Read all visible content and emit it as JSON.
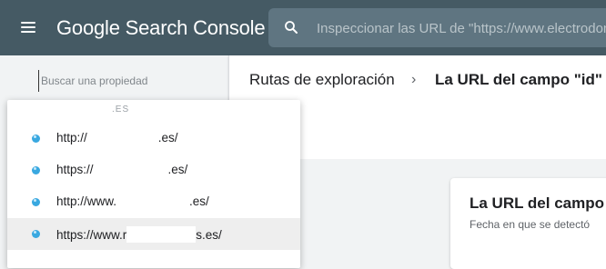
{
  "header": {
    "brand_google": "Google",
    "brand_product": "Search Console",
    "search_placeholder": "Inspeccionar las URL de \"https://www.electrodomest"
  },
  "property_search": {
    "placeholder": "Buscar una propiedad"
  },
  "breadcrumb": {
    "parent": "Rutas de exploración",
    "separator": "›",
    "current": "La URL del campo \"id\" n"
  },
  "card": {
    "title": "La URL del campo",
    "subtitle": "Fecha en que se detectó"
  },
  "dropdown": {
    "header_fragment": ".ES",
    "properties": [
      {
        "prefix": "http://",
        "suffix": ".es/",
        "selected": false
      },
      {
        "prefix": "https://",
        "suffix": ".es/",
        "selected": false
      },
      {
        "prefix": "http://www.",
        "suffix": ".es/",
        "selected": false
      },
      {
        "prefix": "https://www.r",
        "suffix": "s.es/",
        "selected": true
      }
    ]
  },
  "colors": {
    "topbar": "#455a64",
    "property_dot": "#39a8e0"
  }
}
